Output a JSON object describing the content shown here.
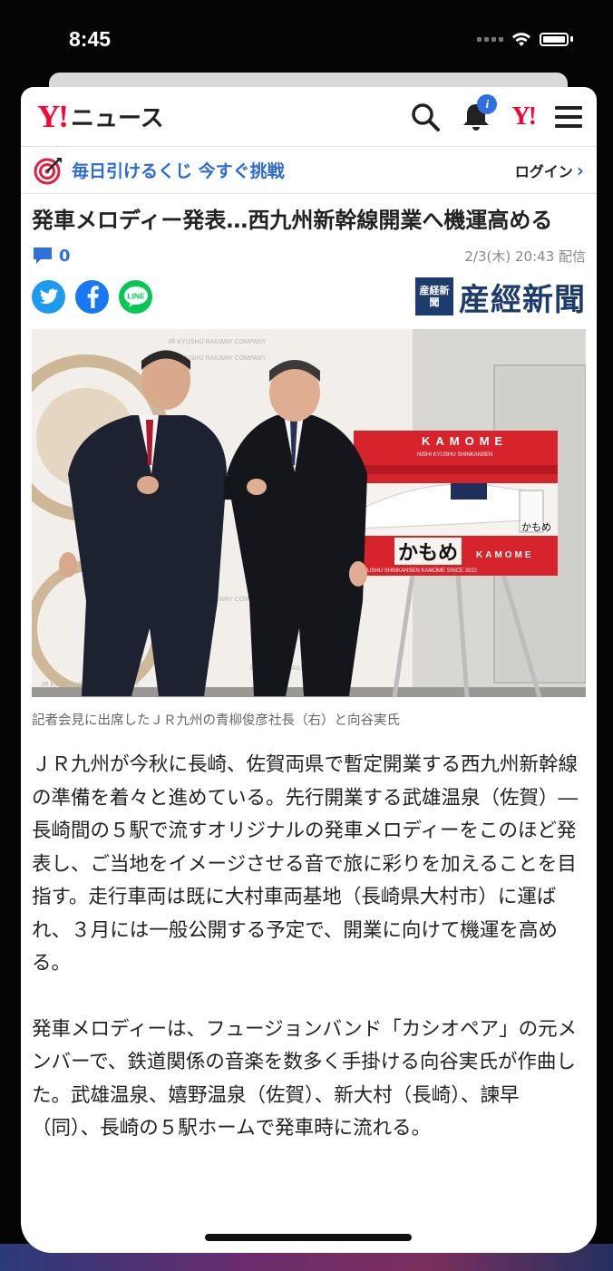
{
  "status_bar": {
    "time": "8:45"
  },
  "header": {
    "logo_mark": "Y!",
    "logo_text": "ニュース",
    "yj_logo": "Y!",
    "notification_count": "i"
  },
  "promo": {
    "text": "毎日引けるくじ 今すぐ挑戦",
    "login_label": "ログイン"
  },
  "article": {
    "title": "発車メロディー発表…西九州新幹線開業へ機運高める",
    "comment_count": "0",
    "published": "2/3(木) 20:43 配信",
    "publisher_seal": "産経新聞",
    "publisher": "産經新聞",
    "photo": {
      "banner_title": "KAMOME",
      "banner_subtitle": "NISHI KYUSHU SHINKANSEN",
      "banner_kana": "かもめ",
      "banner_bottom": "KYUSHU SHINKANSEN KAMOME SINCE 2022",
      "wall_text": "JR KYUSHU RAILWAY COMPANY"
    },
    "caption": "記者会見に出席したＪＲ九州の青柳俊彦社長（右）と向谷実氏",
    "paragraphs": [
      "ＪＲ九州が今秋に長崎、佐賀両県で暫定開業する西九州新幹線の準備を着々と進めている。先行開業する武雄温泉（佐賀）―長崎間の５駅で流すオリジナルの発車メロディーをこのほど発表し、ご当地をイメージさせる音で旅に彩りを加えることを目指す。走行車両は既に大村車両基地（長崎県大村市）に運ばれ、３月には一般公開する予定で、開業に向けて機運を高める。",
      "発車メロディーは、フュージョンバンド「カシオペア」の元メンバーで、鉄道関係の音楽を数多く手掛ける向谷実氏が作曲した。武雄温泉、嬉野温泉（佐賀）、新大村（長崎）、諫早（同）、長崎の５駅ホームで発車時に流れる。"
    ]
  },
  "icons": {
    "search": "search-icon",
    "bell": "bell-icon",
    "menu": "hamburger-menu-icon",
    "promo": "target-icon",
    "comment": "comment-icon",
    "twitter": "twitter-icon",
    "facebook": "facebook-icon",
    "line": "line-icon",
    "wifi": "wifi-icon",
    "battery": "battery-icon",
    "chevron": "chevron-right-icon"
  },
  "colors": {
    "yahoo_red": "#ff0033",
    "link_blue": "#2a6ad2",
    "twitter": "#1d9bf0",
    "facebook": "#1877f2",
    "line": "#06c755",
    "sankei_navy": "#1e3b6e"
  }
}
